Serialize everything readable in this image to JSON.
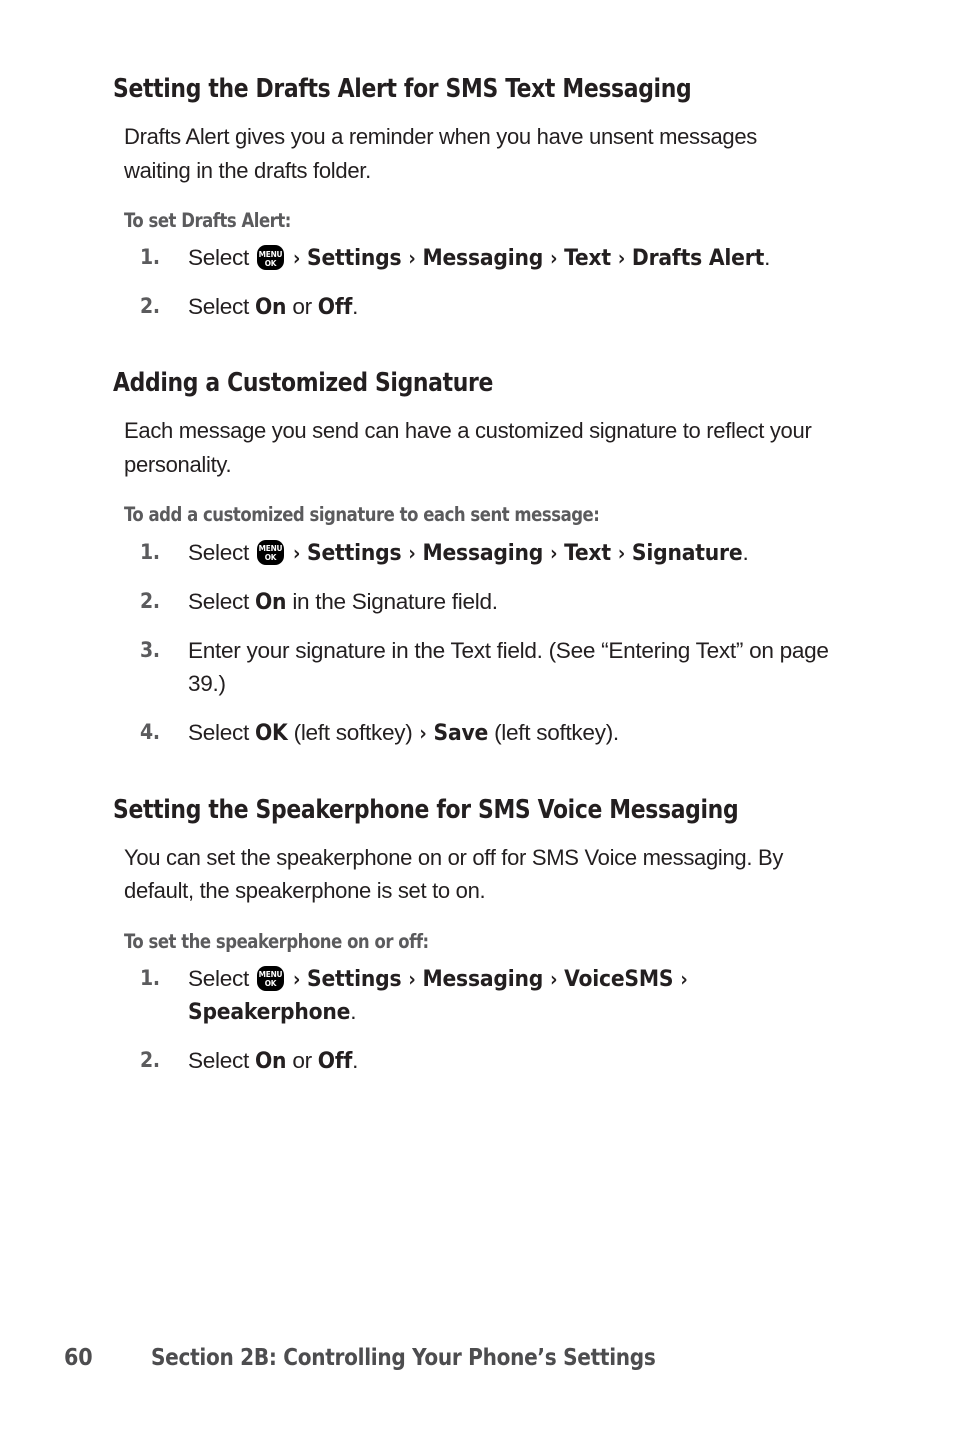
{
  "document": {
    "page_number": "60",
    "footer_text": "Section 2B: Controlling Your Phone’s Settings"
  },
  "icons": {
    "menu_ok": {
      "top_label": "MENU",
      "bottom_label": "OK",
      "name": "menu-ok-key-icon"
    },
    "chevron": "›"
  },
  "colors": {
    "heading": "#231f20",
    "body": "#231f20",
    "subheading": "#5b5b5d",
    "list_number": "#5b5b5d",
    "footer": "#4d4d4f",
    "background": "#ffffff"
  },
  "sections": [
    {
      "heading": "Setting the Drafts Alert for SMS Text Messaging",
      "paragraph": "Drafts Alert gives you a reminder when you have unsent messages waiting in the drafts folder.",
      "subheading": "To set Drafts Alert:",
      "steps": [
        {
          "number": "1.",
          "parts": [
            {
              "type": "text",
              "value": "Select "
            },
            {
              "type": "icon",
              "value": "menu_ok"
            },
            {
              "type": "chev"
            },
            {
              "type": "bold",
              "value": "Settings"
            },
            {
              "type": "chev"
            },
            {
              "type": "bold",
              "value": "Messaging"
            },
            {
              "type": "chev"
            },
            {
              "type": "bold",
              "value": "Text"
            },
            {
              "type": "chev"
            },
            {
              "type": "bold",
              "value": "Drafts Alert"
            },
            {
              "type": "text",
              "value": "."
            }
          ]
        },
        {
          "number": "2.",
          "parts": [
            {
              "type": "text",
              "value": "Select "
            },
            {
              "type": "bold",
              "value": "On"
            },
            {
              "type": "text",
              "value": " or "
            },
            {
              "type": "bold",
              "value": "Off"
            },
            {
              "type": "text",
              "value": "."
            }
          ]
        }
      ]
    },
    {
      "heading": "Adding a Customized Signature",
      "paragraph": "Each message you send can have a customized signature to reflect your personality.",
      "subheading": "To add a customized signature to each sent message:",
      "steps": [
        {
          "number": "1.",
          "parts": [
            {
              "type": "text",
              "value": "Select "
            },
            {
              "type": "icon",
              "value": "menu_ok"
            },
            {
              "type": "chev"
            },
            {
              "type": "bold",
              "value": "Settings"
            },
            {
              "type": "chev"
            },
            {
              "type": "bold",
              "value": "Messaging"
            },
            {
              "type": "chev"
            },
            {
              "type": "bold",
              "value": "Text"
            },
            {
              "type": "chev"
            },
            {
              "type": "bold",
              "value": "Signature"
            },
            {
              "type": "text",
              "value": "."
            }
          ]
        },
        {
          "number": "2.",
          "parts": [
            {
              "type": "text",
              "value": "Select "
            },
            {
              "type": "bold",
              "value": "On"
            },
            {
              "type": "text",
              "value": " in the Signature field."
            }
          ]
        },
        {
          "number": "3.",
          "parts": [
            {
              "type": "text",
              "value": "Enter your signature in the Text field. (See “Entering Text” on page 39.)"
            }
          ]
        },
        {
          "number": "4.",
          "parts": [
            {
              "type": "text",
              "value": "Select "
            },
            {
              "type": "bold",
              "value": "OK"
            },
            {
              "type": "text",
              "value": " (left softkey) "
            },
            {
              "type": "chev"
            },
            {
              "type": "bold",
              "value": "Save"
            },
            {
              "type": "text",
              "value": " (left softkey)."
            }
          ]
        }
      ]
    },
    {
      "heading": "Setting the Speakerphone for SMS Voice Messaging",
      "paragraph": "You can set the speakerphone on or off for SMS Voice messaging. By default, the speakerphone is set to on.",
      "subheading": "To set the speakerphone on or off:",
      "steps": [
        {
          "number": "1.",
          "parts": [
            {
              "type": "text",
              "value": "Select "
            },
            {
              "type": "icon",
              "value": "menu_ok"
            },
            {
              "type": "chev"
            },
            {
              "type": "bold",
              "value": "Settings"
            },
            {
              "type": "chev"
            },
            {
              "type": "bold",
              "value": "Messaging"
            },
            {
              "type": "chev"
            },
            {
              "type": "bold",
              "value": "VoiceSMS"
            },
            {
              "type": "chev"
            },
            {
              "type": "bold",
              "value": "Speakerphone"
            },
            {
              "type": "text",
              "value": "."
            }
          ]
        },
        {
          "number": "2.",
          "parts": [
            {
              "type": "text",
              "value": "Select "
            },
            {
              "type": "bold",
              "value": "On"
            },
            {
              "type": "text",
              "value": " or "
            },
            {
              "type": "bold",
              "value": "Off"
            },
            {
              "type": "text",
              "value": "."
            }
          ]
        }
      ]
    }
  ]
}
